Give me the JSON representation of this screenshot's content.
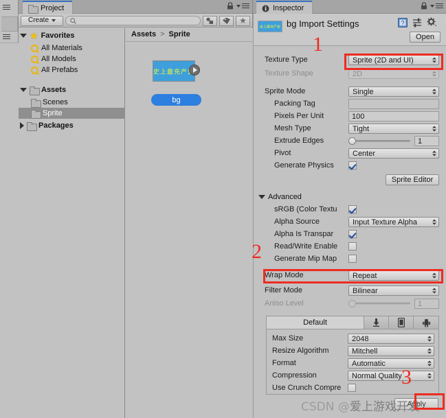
{
  "window": {
    "background_color": "#c2c2c2",
    "accent_blue": "#2d7fe0",
    "annotation_red": "#ee2b20"
  },
  "project_panel": {
    "tab_label": "Project",
    "tab_icon": "folder-icon",
    "lock_icon": "lock-icon",
    "menu_icon": "panel-menu-icon",
    "toolbar": {
      "create_label": "Create",
      "create_dropdown_icon": "chevron-down-icon",
      "search_placeholder": "",
      "search_icon": "search-icon",
      "filter_type_icon": "filter-by-type-icon",
      "filter_label_icon": "filter-by-label-icon",
      "favorite_icon": "star-icon"
    },
    "tree": [
      {
        "label": "Favorites",
        "icon": "star-icon",
        "depth": 0,
        "expanded": true,
        "bold": true,
        "selected": false
      },
      {
        "label": "All Materials",
        "icon": "search-icon",
        "depth": 1,
        "expanded": null,
        "bold": false,
        "selected": false
      },
      {
        "label": "All Models",
        "icon": "search-icon",
        "depth": 1,
        "expanded": null,
        "bold": false,
        "selected": false
      },
      {
        "label": "All Prefabs",
        "icon": "search-icon",
        "depth": 1,
        "expanded": null,
        "bold": false,
        "selected": false
      },
      {
        "label": "Assets",
        "icon": "folder-icon",
        "depth": 0,
        "expanded": true,
        "bold": true,
        "selected": false
      },
      {
        "label": "Scenes",
        "icon": "folder-icon",
        "depth": 1,
        "expanded": null,
        "bold": false,
        "selected": false
      },
      {
        "label": "Sprite",
        "icon": "folder-icon",
        "depth": 1,
        "expanded": null,
        "bold": false,
        "selected": true
      },
      {
        "label": "Packages",
        "icon": "folder-icon",
        "depth": 0,
        "expanded": false,
        "bold": true,
        "selected": false
      }
    ],
    "breadcrumb": {
      "root": "Assets",
      "separator": ">",
      "current": "Sprite"
    },
    "asset": {
      "name": "bg",
      "thumbnail_glyphs": "史上最充产史",
      "expand_icon": "play-expand-icon"
    }
  },
  "inspector": {
    "tab_label": "Inspector",
    "tab_icon": "info-icon",
    "lock_icon": "lock-icon",
    "menu_icon": "panel-menu-icon",
    "title": "bg Import Settings",
    "help_icon": "help-book-icon",
    "preset_icon": "preset-icon",
    "settings_icon": "gear-icon",
    "open_button": "Open",
    "texture_type": {
      "label": "Texture Type",
      "value": "Sprite (2D and UI)"
    },
    "texture_shape": {
      "label": "Texture Shape",
      "value": "2D",
      "disabled": true
    },
    "sprite_mode": {
      "label": "Sprite Mode",
      "value": "Single"
    },
    "packing_tag": {
      "label": "Packing Tag",
      "value": ""
    },
    "pixels_per_unit": {
      "label": "Pixels Per Unit",
      "value": "100"
    },
    "mesh_type": {
      "label": "Mesh Type",
      "value": "Tight"
    },
    "extrude_edges": {
      "label": "Extrude Edges",
      "value": "1",
      "slider_pct": 0
    },
    "pivot": {
      "label": "Pivot",
      "value": "Center"
    },
    "generate_physics": {
      "label": "Generate Physics",
      "checked": true
    },
    "sprite_editor_button": "Sprite Editor",
    "advanced": {
      "label": "Advanced",
      "expanded": true,
      "srgb": {
        "label": "sRGB (Color Textu",
        "checked": true
      },
      "alpha_source": {
        "label": "Alpha Source",
        "value": "Input Texture Alpha"
      },
      "alpha_is_transparency": {
        "label": "Alpha Is Transpar",
        "checked": true
      },
      "read_write_enabled": {
        "label": "Read/Write Enable",
        "checked": false
      },
      "generate_mip_maps": {
        "label": "Generate Mip Map",
        "checked": false
      }
    },
    "wrap_mode": {
      "label": "Wrap Mode",
      "value": "Repeat"
    },
    "filter_mode": {
      "label": "Filter Mode",
      "value": "Bilinear"
    },
    "aniso_level": {
      "label": "Aniso Level",
      "value": "1",
      "disabled": true,
      "slider_pct": 0
    },
    "platform_tabs": [
      {
        "label": "Default",
        "icon": "default-platform-tab",
        "active": true
      },
      {
        "label": "",
        "icon": "standalone-download-icon",
        "active": false
      },
      {
        "label": "",
        "icon": "iphone-icon",
        "active": false
      },
      {
        "label": "",
        "icon": "android-icon",
        "active": false
      }
    ],
    "platform_settings": {
      "max_size": {
        "label": "Max Size",
        "value": "2048"
      },
      "resize_algorithm": {
        "label": "Resize Algorithm",
        "value": "Mitchell"
      },
      "format": {
        "label": "Format",
        "value": "Automatic"
      },
      "compression": {
        "label": "Compression",
        "value": "Normal Quality"
      },
      "use_crunch_compression": {
        "label": "Use Crunch Compre",
        "checked": false
      }
    },
    "apply_button": "Apply"
  },
  "annotations": {
    "markers": [
      {
        "number": "1",
        "target": "texture-type-row"
      },
      {
        "number": "2",
        "target": "wrap-mode-row"
      },
      {
        "number": "3",
        "target": "compression-row"
      }
    ],
    "watermark_prefix": "CSDN @",
    "watermark_text": "爱上游戏开发"
  }
}
